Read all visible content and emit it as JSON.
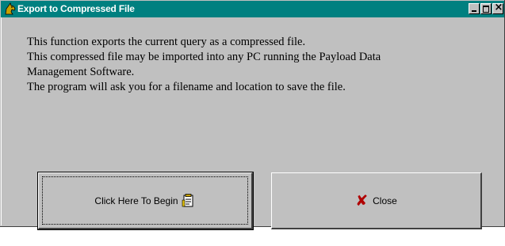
{
  "window": {
    "title": "Export to Compressed File",
    "icon": "horse-head-icon",
    "controls": {
      "minimize": "minimize-icon",
      "maximize": "maximize-icon",
      "close": "close-icon"
    }
  },
  "description": [
    "This function exports the current query as a compressed file.",
    "This compressed file may be imported into any PC running the Payload Data",
    "Management Software.",
    "The program will ask you for a filename and location to save the file."
  ],
  "buttons": {
    "begin": {
      "label": "Click Here To Begin",
      "icon": "document-icon"
    },
    "close": {
      "label": "Close",
      "icon": "red-x-icon"
    }
  },
  "colors": {
    "titlebar": "#008080",
    "face": "#c0c0c0",
    "close_x": "#b00000"
  }
}
